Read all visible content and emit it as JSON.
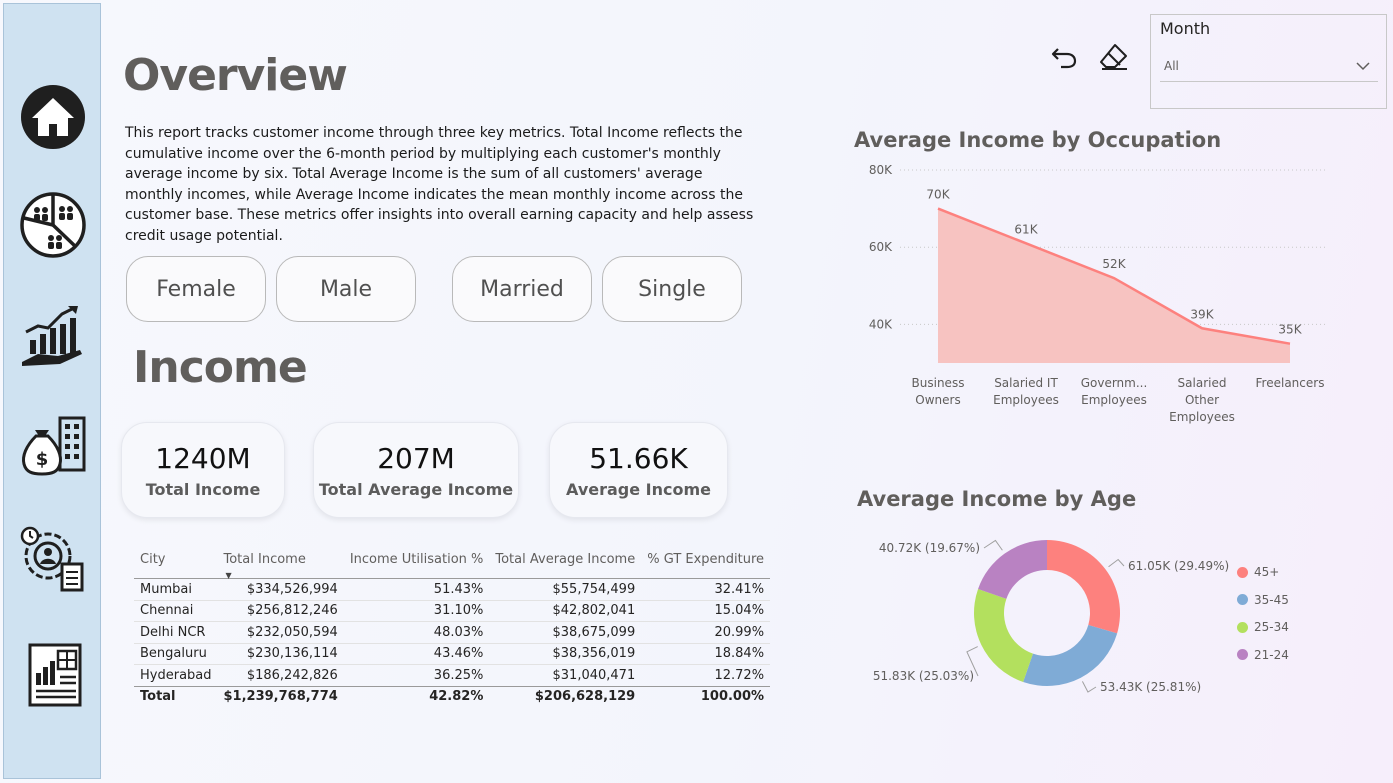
{
  "page": {
    "title": "Overview",
    "section_title": "Income",
    "description": "This report tracks customer income through three key metrics. Total Income reflects the cumulative income over the 6-month period by multiplying each customer's monthly average income by six. Total Average Income is the sum of all customers' average monthly incomes, while Average Income indicates the mean monthly income across the customer base. These metrics offer insights into overall earning capacity and help assess credit usage potential."
  },
  "sidebar": {
    "items": [
      {
        "icon": "home-icon"
      },
      {
        "icon": "demographics-pie-icon"
      },
      {
        "icon": "growth-chart-hand-icon"
      },
      {
        "icon": "money-bag-building-icon"
      },
      {
        "icon": "customer-settings-icon"
      },
      {
        "icon": "report-document-icon"
      }
    ]
  },
  "filters": {
    "buttons": [
      "Female",
      "Male",
      "Married",
      "Single"
    ]
  },
  "month_slicer": {
    "label": "Month",
    "value": "All"
  },
  "kpis": [
    {
      "value": "1240M",
      "label": "Total Income"
    },
    {
      "value": "207M",
      "label": "Total Average Income"
    },
    {
      "value": "51.66K",
      "label": "Average Income"
    }
  ],
  "table": {
    "headers": [
      "City",
      "Total Income",
      "Income Utilisation %",
      "Total Average Income",
      "% GT Expenditure"
    ],
    "rows": [
      [
        "Mumbai",
        "$334,526,994",
        "51.43%",
        "$55,754,499",
        "32.41%"
      ],
      [
        "Chennai",
        "$256,812,246",
        "31.10%",
        "$42,802,041",
        "15.04%"
      ],
      [
        "Delhi NCR",
        "$232,050,594",
        "48.03%",
        "$38,675,099",
        "20.99%"
      ],
      [
        "Bengaluru",
        "$230,136,114",
        "43.46%",
        "$38,356,019",
        "18.84%"
      ],
      [
        "Hyderabad",
        "$186,242,826",
        "36.25%",
        "$31,040,471",
        "12.72%"
      ]
    ],
    "total": [
      "Total",
      "$1,239,768,774",
      "42.82%",
      "$206,628,129",
      "100.00%"
    ]
  },
  "chart_data": [
    {
      "type": "area",
      "title": "Average Income by Occupation",
      "categories": [
        [
          "Business",
          "Owners"
        ],
        [
          "Salaried IT",
          "Employees"
        ],
        [
          "Governm...",
          "Employees"
        ],
        [
          "Salaried",
          "Other",
          "Employees"
        ],
        [
          "Freelancers"
        ]
      ],
      "values": [
        70,
        61,
        52,
        39,
        35
      ],
      "data_labels": [
        "70K",
        "61K",
        "52K",
        "39K",
        "35K"
      ],
      "y_ticks": [
        "40K",
        "60K",
        "80K"
      ],
      "y_tick_values": [
        40,
        60,
        80
      ],
      "ylim": [
        30,
        80
      ],
      "color": "#fd817e",
      "fill_color": "#f7c3c1"
    },
    {
      "type": "pie",
      "title": "Average Income by Age",
      "categories": [
        "45+",
        "35-45",
        "25-34",
        "21-24"
      ],
      "values": [
        61.05,
        53.43,
        51.83,
        40.72
      ],
      "data_labels": [
        "61.05K (29.49%)",
        "53.43K (25.81%)",
        "51.83K (25.03%)",
        "40.72K (19.67%)"
      ],
      "colors": [
        "#fd817e",
        "#7fabd6",
        "#b3e05e",
        "#b982c2"
      ],
      "legend_position": "right"
    }
  ]
}
